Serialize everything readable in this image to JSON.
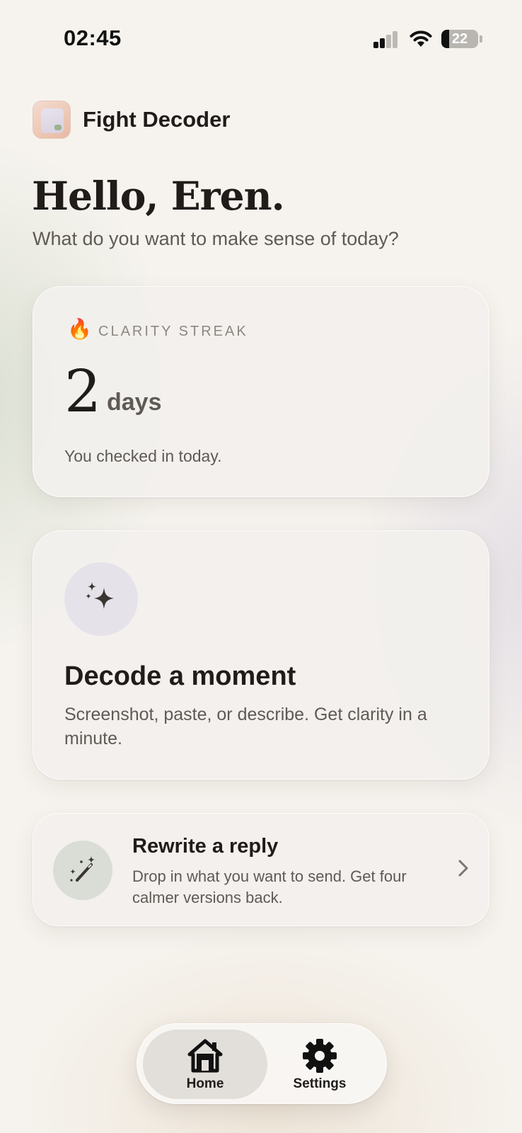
{
  "status_bar": {
    "time": "02:45",
    "battery_level": "22"
  },
  "header": {
    "app_name": "Fight Decoder"
  },
  "greeting": {
    "title": "Hello, Eren.",
    "subtitle": "What do you want to make sense of today?"
  },
  "streak_card": {
    "icon": "🔥",
    "label": "CLARITY STREAK",
    "value": "2",
    "unit": "days",
    "note": "You checked in today."
  },
  "decode_card": {
    "icon": "sparkles-icon",
    "title": "Decode a moment",
    "description": "Screenshot, paste, or describe. Get clarity in a minute."
  },
  "rewrite_card": {
    "icon": "magic-wand-icon",
    "title": "Rewrite a reply",
    "description": "Drop in what you want to send. Get four calmer versions back."
  },
  "tab_bar": {
    "tabs": [
      {
        "label": "Home",
        "icon": "home-icon",
        "selected": true
      },
      {
        "label": "Settings",
        "icon": "gear-icon",
        "selected": false
      }
    ]
  },
  "colors": {
    "background": "#f6f3ee",
    "card": "#f2f0ed",
    "text_primary": "#1f1c1a",
    "text_secondary": "#5f5a55",
    "decode_icon_bg": "#e6e2ea",
    "rewrite_icon_bg": "#d9ddd5"
  }
}
